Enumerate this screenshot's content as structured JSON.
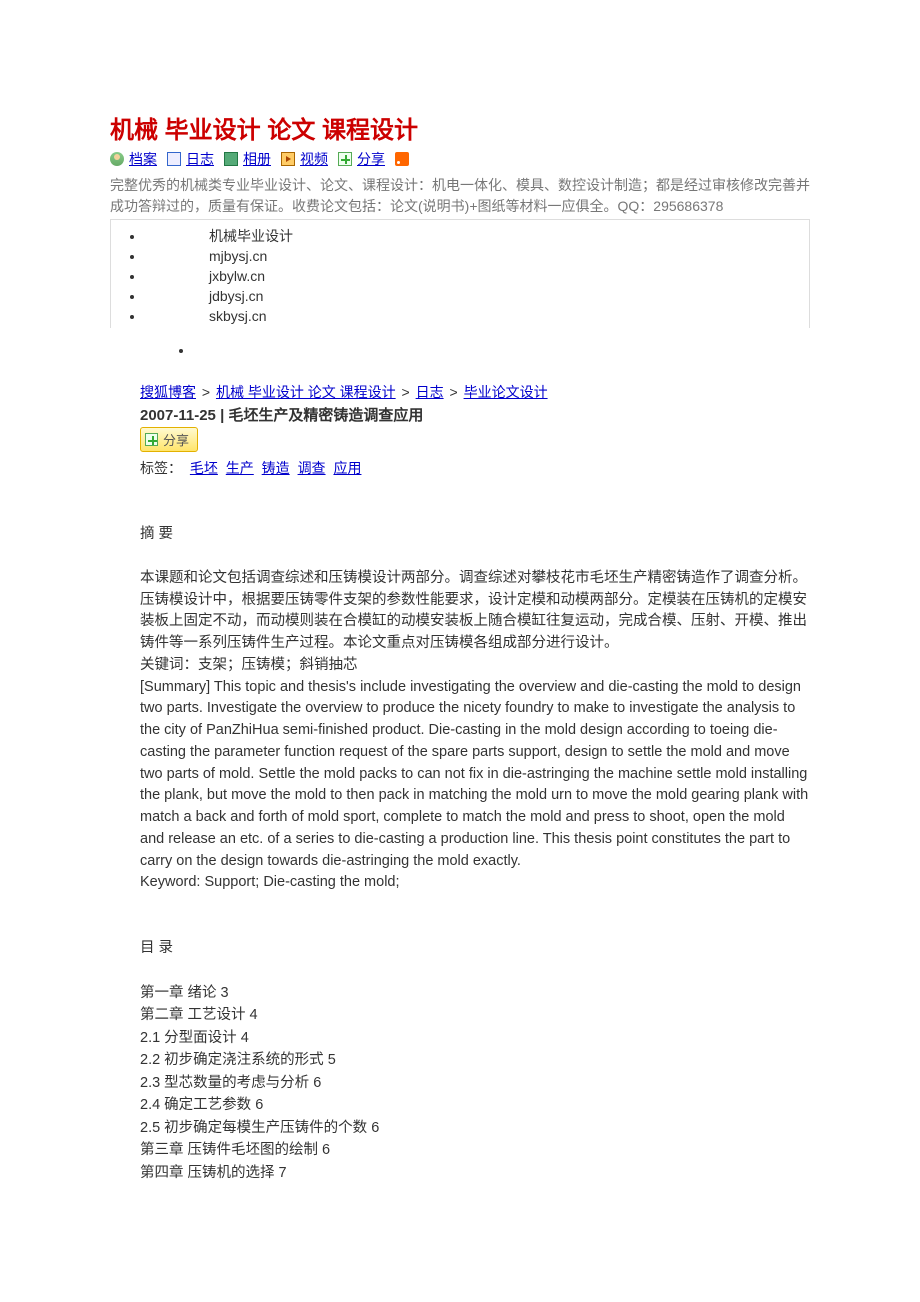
{
  "blog": {
    "title": "机械 毕业设计 论文 课程设计",
    "tabs": {
      "profile": "档案",
      "posts": "日志",
      "album": "相册",
      "video": "视频",
      "share": "分享"
    },
    "description": "完整优秀的机械类专业毕业设计、论文、课程设计：机电一体化、模具、数控设计制造；都是经过审核修改完善并成功答辩过的，质量有保证。收费论文包括：论文(说明书)+图纸等材料一应俱全。QQ：295686378"
  },
  "sidebar": {
    "items": [
      "机械毕业设计",
      "mjbysj.cn",
      "jxbylw.cn",
      "jdbysj.cn",
      "skbysj.cn"
    ]
  },
  "breadcrumb": {
    "home": "搜狐博客",
    "blog": "机械 毕业设计 论文 课程设计",
    "posts": "日志",
    "category": "毕业论文设计",
    "sep": ">"
  },
  "post": {
    "date_title": "2007-11-25 | 毛坯生产及精密铸造调查应用",
    "share_label": "分享",
    "tags_label": "标签：",
    "tags": [
      "毛坯",
      "生产",
      "铸造",
      "调查",
      "应用"
    ],
    "abstract_label": "摘 要",
    "abstract_cn": "本课题和论文包括调查综述和压铸模设计两部分。调查综述对攀枝花市毛坯生产精密铸造作了调查分析。压铸模设计中，根据要压铸零件支架的参数性能要求，设计定模和动模两部分。定模装在压铸机的定模安装板上固定不动，而动模则装在合模缸的动模安装板上随合模缸往复运动，完成合模、压射、开模、推出铸件等一系列压铸件生产过程。本论文重点对压铸模各组成部分进行设计。",
    "keywords_cn": "关键词：支架；压铸模；斜销抽芯",
    "abstract_en": "[Summary] This topic and thesis's include investigating the overview and die-casting the mold to design two parts. Investigate the overview to produce the nicety foundry to make to investigate the analysis to the city of PanZhiHua semi-finished product. Die-casting in the mold design according to toeing die-casting the parameter function request of the spare parts support, design to settle the mold and move two parts of mold. Settle the mold packs to can not fix in die-astringing the machine settle mold installing the plank, but move the mold to then pack in matching the mold urn to move the mold gearing plank with match a back and forth of mold sport, complete to match the mold and press to shoot, open the mold and release an etc. of a series to die-casting a production line. This thesis point constitutes the part to carry on the design towards die-astringing the mold exactly.",
    "keywords_en": "Keyword: Support; Die-casting the mold;",
    "toc_label": "目    录",
    "toc": [
      "第一章 绪论 3",
      "第二章  工艺设计 4",
      "2.1 分型面设计 4",
      "2.2 初步确定浇注系统的形式 5",
      "2.3 型芯数量的考虑与分析 6",
      "2.4 确定工艺参数 6",
      "2.5 初步确定每模生产压铸件的个数 6",
      "第三章  压铸件毛坯图的绘制 6",
      "第四章  压铸机的选择 7"
    ]
  }
}
